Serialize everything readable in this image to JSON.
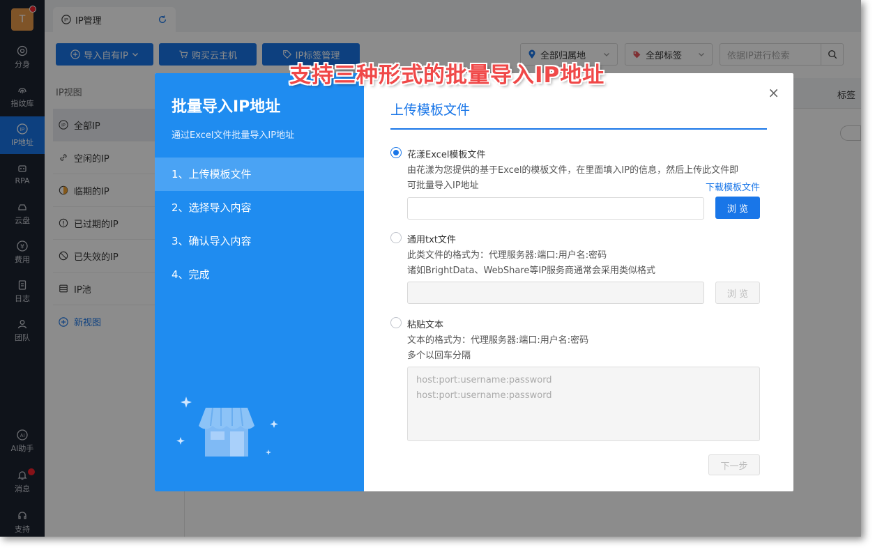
{
  "rail": {
    "avatar_letter": "T",
    "items": [
      {
        "label": "分身",
        "icon": "chrome-icon"
      },
      {
        "label": "指纹库",
        "icon": "fingerprint-icon"
      },
      {
        "label": "IP地址",
        "icon": "ip-icon"
      },
      {
        "label": "RPA",
        "icon": "robot-icon"
      },
      {
        "label": "云盘",
        "icon": "cloud-drive-icon"
      },
      {
        "label": "费用",
        "icon": "yen-icon"
      },
      {
        "label": "日志",
        "icon": "log-icon"
      },
      {
        "label": "团队",
        "icon": "team-icon"
      },
      {
        "label": "AI助手",
        "icon": "ai-icon"
      },
      {
        "label": "消息",
        "icon": "bell-icon"
      },
      {
        "label": "支持",
        "icon": "headset-icon"
      }
    ]
  },
  "tabbar": {
    "tab_label": "IP管理"
  },
  "toolbar": {
    "import_label": "导入自有IP",
    "buy_label": "购买云主机",
    "tag_mgmt_label": "IP标签管理",
    "region_filter": "全部归属地",
    "tag_filter": "全部标签",
    "search_placeholder": "依据IP进行检索"
  },
  "views": {
    "title": "IP视图",
    "items": [
      "全部IP",
      "空闲的IP",
      "临期的IP",
      "已过期的IP",
      "已失效的IP",
      "IP池"
    ],
    "new_view": "新视图"
  },
  "table": {
    "tag_header": "标签"
  },
  "modal": {
    "title": "批量导入IP地址",
    "subtitle": "通过Excel文件批量导入IP地址",
    "steps": [
      "1、上传模板文件",
      "2、选择导入内容",
      "3、确认导入内容",
      "4、完成"
    ],
    "section_title": "上传模板文件",
    "option1": {
      "label": "花漾Excel模板文件",
      "desc1": "由花漾为您提供的基于Excel的模板文件，在里面填入IP的信息，然后上传此文件即",
      "desc2": "可批量导入IP地址",
      "download_link": "下载模板文件",
      "browse": "浏 览"
    },
    "option2": {
      "label": "通用txt文件",
      "desc1": "此类文件的格式为：代理服务器:端口:用户名:密码",
      "desc2": "诸如BrightData、WebShare等IP服务商通常会采用类似格式",
      "browse": "浏 览"
    },
    "option3": {
      "label": "粘贴文本",
      "desc1": "文本的格式为：代理服务器:端口:用户名:密码",
      "desc2": "多个以回车分隔",
      "placeholder1": "host:port:username:password",
      "placeholder2": "host:port:username:password"
    },
    "next": "下一步",
    "close": "×"
  },
  "annotation": "支持三种形式的批量导入IP地址",
  "colors": {
    "primary": "#1976e8",
    "modal_left": "#1f8cf0",
    "annotation": "#f04848"
  }
}
